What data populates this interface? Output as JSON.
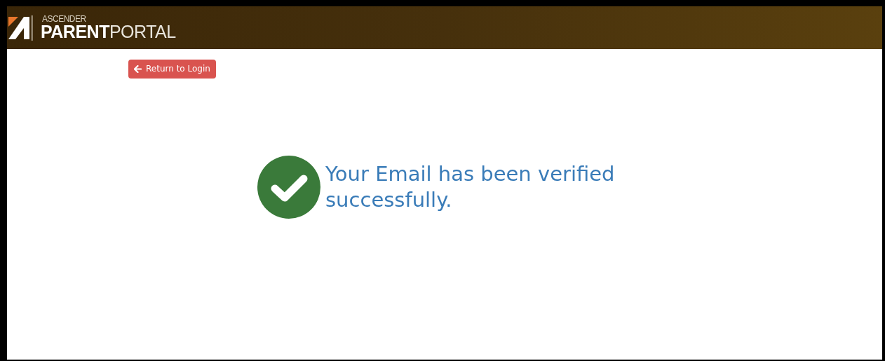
{
  "header": {
    "brand_small": "ASCENDER",
    "brand_large": "**PARENT**PORTAL"
  },
  "return_button": {
    "label": "Return to Login"
  },
  "message": {
    "text": "Your Email has been verified successfully."
  }
}
